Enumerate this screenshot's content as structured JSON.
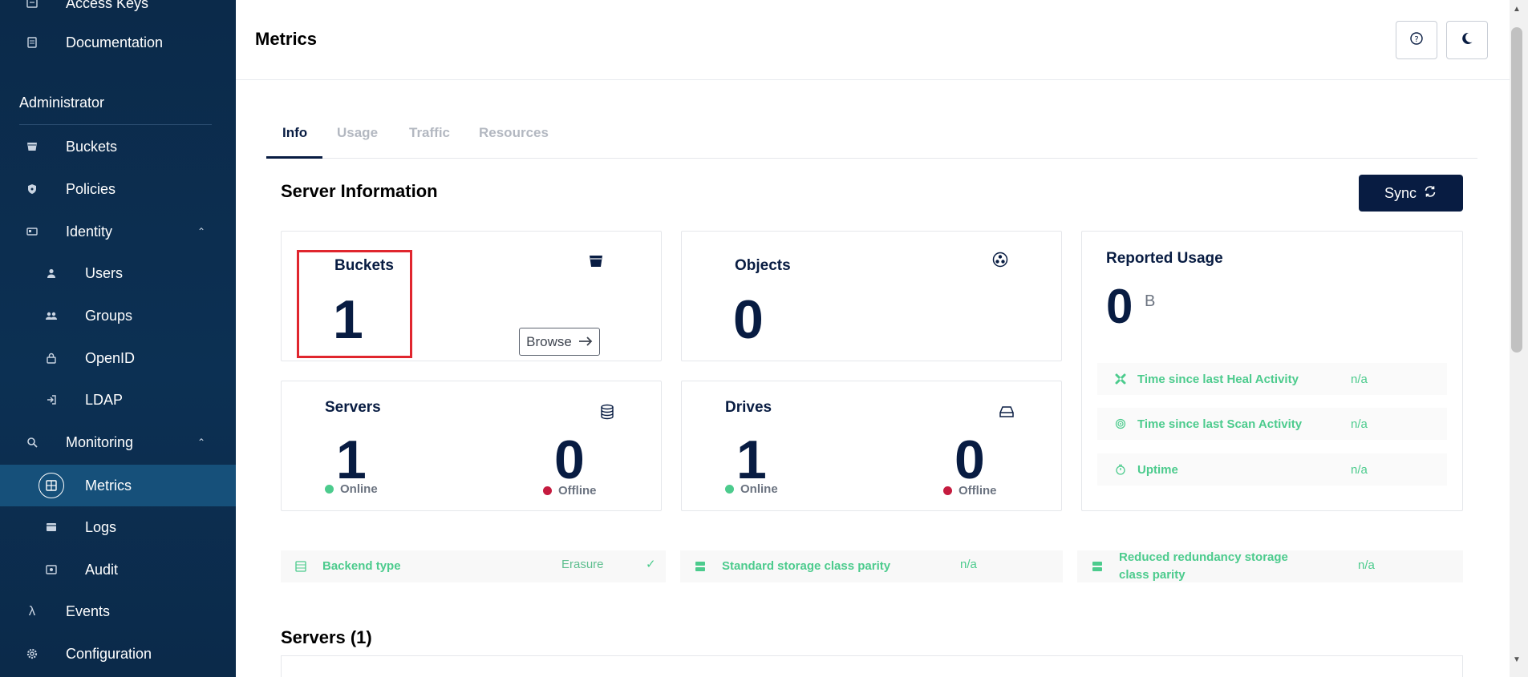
{
  "sidebar": {
    "items_top": [
      {
        "label": "Access Keys",
        "icon": "key-icon"
      },
      {
        "label": "Documentation",
        "icon": "document-icon"
      }
    ],
    "section_label": "Administrator",
    "items": [
      {
        "label": "Buckets",
        "icon": "bucket-icon"
      },
      {
        "label": "Policies",
        "icon": "shield-icon"
      },
      {
        "label": "Identity",
        "icon": "id-card-icon",
        "expanded": true
      },
      {
        "label": "Users",
        "icon": "user-icon"
      },
      {
        "label": "Groups",
        "icon": "group-icon"
      },
      {
        "label": "OpenID",
        "icon": "lock-icon"
      },
      {
        "label": "LDAP",
        "icon": "login-icon"
      },
      {
        "label": "Monitoring",
        "icon": "search-icon",
        "expanded": true
      },
      {
        "label": "Metrics",
        "icon": "dashboard-icon",
        "active": true
      },
      {
        "label": "Logs",
        "icon": "logs-icon"
      },
      {
        "label": "Audit",
        "icon": "audit-icon"
      },
      {
        "label": "Events",
        "icon": "lambda-icon"
      },
      {
        "label": "Configuration",
        "icon": "gear-icon"
      }
    ]
  },
  "header": {
    "title": "Metrics",
    "help_icon": "help-icon",
    "theme_icon": "moon-icon"
  },
  "tabs": [
    {
      "label": "Info",
      "active": true
    },
    {
      "label": "Usage"
    },
    {
      "label": "Traffic"
    },
    {
      "label": "Resources"
    }
  ],
  "server_info": {
    "title": "Server Information",
    "sync_label": "Sync",
    "buckets": {
      "label": "Buckets",
      "value": "1",
      "browse_label": "Browse"
    },
    "objects": {
      "label": "Objects",
      "value": "0"
    },
    "servers": {
      "label": "Servers",
      "online": "1",
      "offline": "0",
      "online_label": "Online",
      "offline_label": "Offline"
    },
    "drives": {
      "label": "Drives",
      "online": "1",
      "offline": "0",
      "online_label": "Online",
      "offline_label": "Offline"
    },
    "reported_usage": {
      "label": "Reported Usage",
      "value": "0",
      "unit": "B",
      "rows": [
        {
          "label": "Time since last Heal Activity",
          "value": "n/a"
        },
        {
          "label": "Time since last Scan Activity",
          "value": "n/a"
        },
        {
          "label": "Uptime",
          "value": "n/a"
        }
      ]
    },
    "backend": [
      {
        "label": "Backend type",
        "value": "Erasure"
      },
      {
        "label": "Standard storage class parity",
        "value": "n/a"
      },
      {
        "label": "Reduced redundancy storage class parity",
        "value": "n/a"
      }
    ]
  },
  "servers_section": {
    "title": "Servers (1)"
  },
  "colors": {
    "navy": "#081c42",
    "green": "#4ccb8d",
    "online": "#4ccb8d",
    "offline": "#c51b3f",
    "highlight": "#e0262e"
  }
}
